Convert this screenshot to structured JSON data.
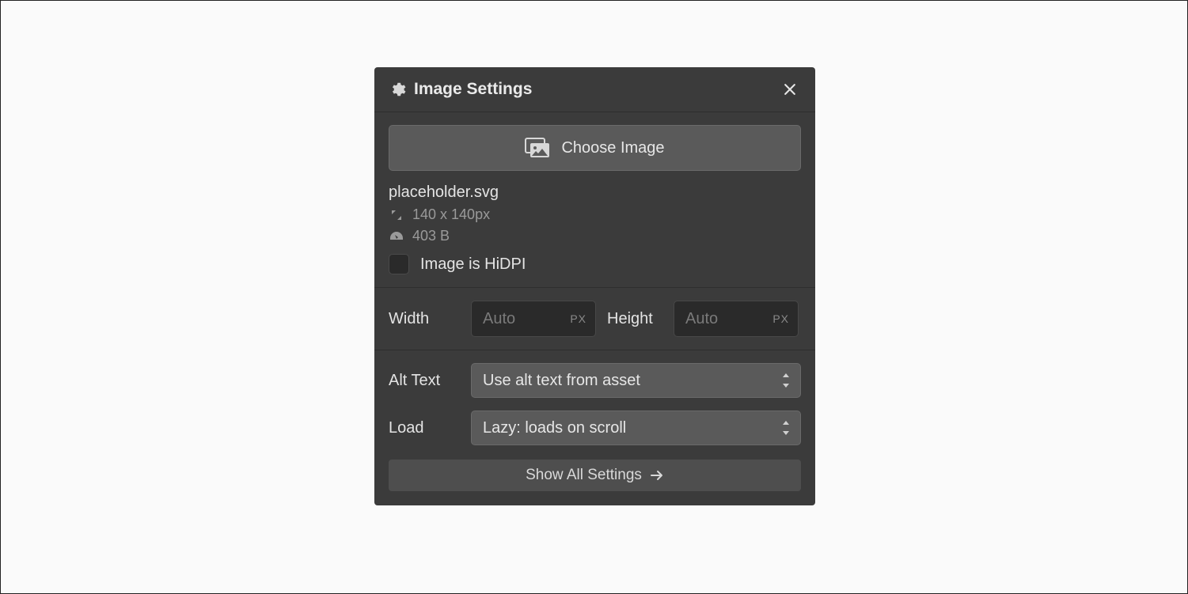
{
  "panel": {
    "title": "Image Settings",
    "choose_button": "Choose Image",
    "filename": "placeholder.svg",
    "dimensions_text": "140 x 140px",
    "filesize_text": "403 B",
    "hidpi_label": "Image is HiDPI",
    "hidpi_checked": false,
    "width_label": "Width",
    "height_label": "Height",
    "width_value": "",
    "height_value": "",
    "dim_placeholder": "Auto",
    "dim_unit": "PX",
    "alt_text_label": "Alt Text",
    "alt_text_value": "Use alt text from asset",
    "load_label": "Load",
    "load_value": "Lazy: loads on scroll",
    "show_all_label": "Show All Settings"
  }
}
